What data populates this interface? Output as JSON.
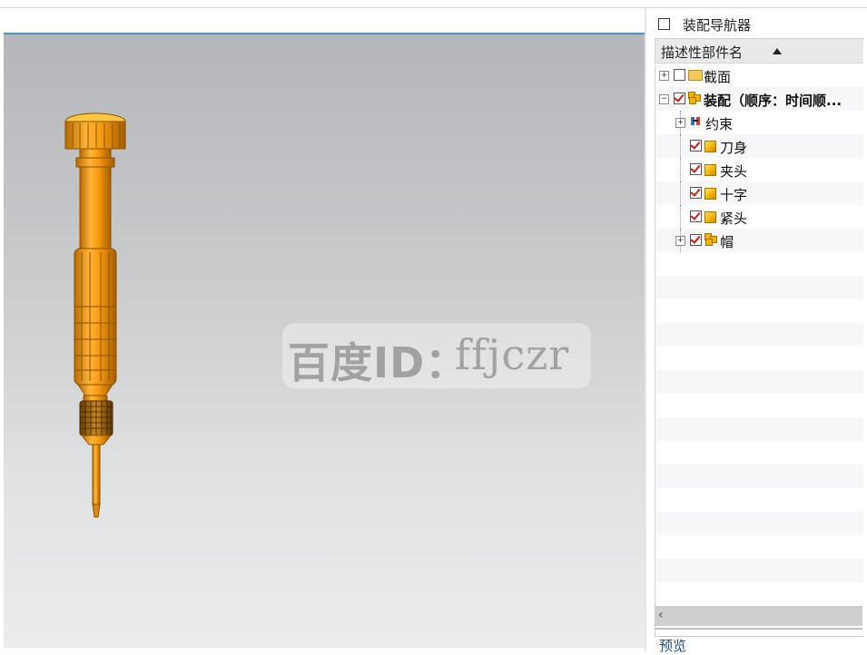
{
  "panel": {
    "title": "装配导航器",
    "column_header": "描述性部件名",
    "preview_label": "预览"
  },
  "tree": [
    {
      "label": "截面",
      "level": 0,
      "expander": "+",
      "checked": false,
      "icon": "folder-icon",
      "bold": false
    },
    {
      "label": "装配（顺序：时间顺...",
      "level": 0,
      "expander": "−",
      "checked": true,
      "icon": "assembly-icon",
      "bold": true
    },
    {
      "label": "约束",
      "level": 1,
      "expander": "+",
      "checked": null,
      "icon": "constraint-icon",
      "bold": false
    },
    {
      "label": "刀身",
      "level": 1,
      "expander": "",
      "checked": true,
      "icon": "part-icon",
      "bold": false
    },
    {
      "label": "夹头",
      "level": 1,
      "expander": "",
      "checked": true,
      "icon": "part-icon",
      "bold": false
    },
    {
      "label": "十字",
      "level": 1,
      "expander": "",
      "checked": true,
      "icon": "part-icon",
      "bold": false
    },
    {
      "label": "紧头",
      "level": 1,
      "expander": "",
      "checked": true,
      "icon": "part-icon",
      "bold": false
    },
    {
      "label": "帽",
      "level": 1,
      "expander": "+",
      "checked": true,
      "icon": "assembly-icon",
      "bold": false
    }
  ],
  "viewport": {
    "watermark_a": "百度ID：",
    "watermark_b": "ffjczr",
    "model_color": "#f0a020"
  },
  "colors": {
    "accent": "#4a93b3",
    "check": "#d01818",
    "part": "#f2b400"
  }
}
